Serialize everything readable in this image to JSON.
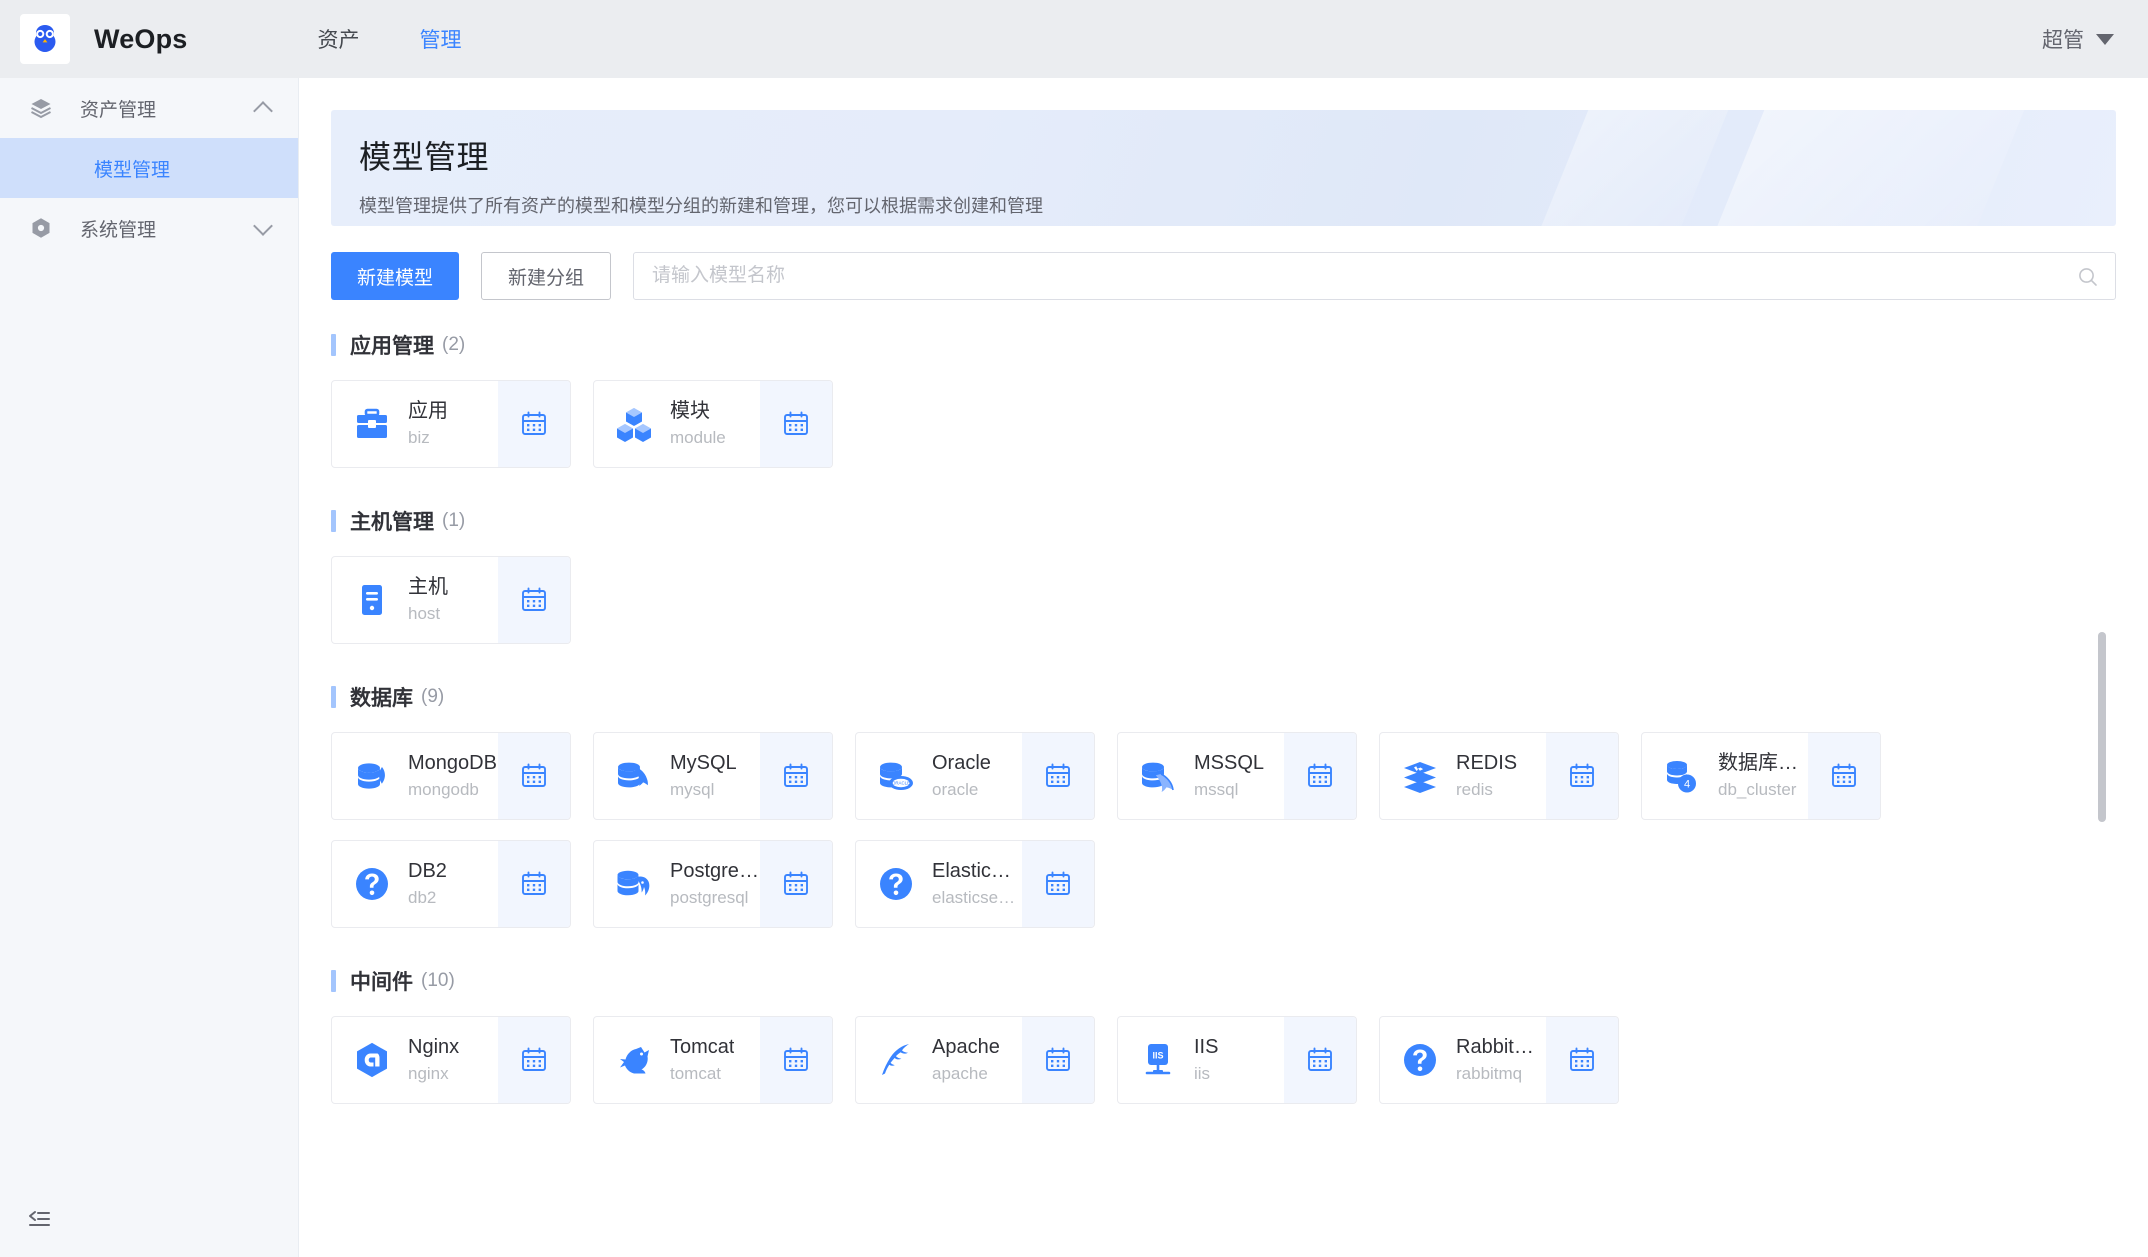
{
  "header": {
    "brand": "WeOps",
    "logo_icon": "owl-logo-icon",
    "nav": [
      {
        "label": "资产",
        "active": false
      },
      {
        "label": "管理",
        "active": true
      }
    ],
    "user": {
      "label": "超管",
      "caret_icon": "caret-down-icon"
    }
  },
  "sidebar": {
    "groups": [
      {
        "label": "资产管理",
        "icon": "layers-icon",
        "chevron": "chevron-up-icon",
        "expanded": true
      },
      {
        "label": "系统管理",
        "icon": "gear-hexagon-icon",
        "chevron": "chevron-down-icon",
        "expanded": false
      }
    ],
    "sub_items": [
      {
        "label": "模型管理",
        "active": true
      }
    ],
    "collapse_icon": "collapse-sidebar-icon"
  },
  "banner": {
    "title": "模型管理",
    "subtitle": "模型管理提供了所有资产的模型和模型分组的新建和管理，您可以根据需求创建和管理"
  },
  "toolbar": {
    "new_model_label": "新建模型",
    "new_group_label": "新建分组",
    "search_placeholder": "请输入模型名称",
    "search_value": "",
    "search_icon": "search-icon"
  },
  "colors": {
    "accent": "#3a84ff",
    "active_nav_bg": "#cfdffb",
    "card_action_bg": "#f2f6fe",
    "icon_blue": "#3a84ff"
  },
  "groups": [
    {
      "name": "应用管理",
      "count": "(2)",
      "models": [
        {
          "title": "应用",
          "code": "biz",
          "icon": "toolbox-icon",
          "action_icon": "calendar-icon"
        },
        {
          "title": "模块",
          "code": "module",
          "icon": "cubes-icon",
          "action_icon": "calendar-icon"
        }
      ]
    },
    {
      "name": "主机管理",
      "count": "(1)",
      "models": [
        {
          "title": "主机",
          "code": "host",
          "icon": "server-icon",
          "action_icon": "calendar-icon"
        }
      ]
    },
    {
      "name": "数据库",
      "count": "(9)",
      "models": [
        {
          "title": "MongoDB",
          "code": "mongodb",
          "icon": "mongodb-icon",
          "action_icon": "calendar-icon"
        },
        {
          "title": "MySQL",
          "code": "mysql",
          "icon": "mysql-icon",
          "action_icon": "calendar-icon"
        },
        {
          "title": "Oracle",
          "code": "oracle",
          "icon": "oracle-icon",
          "action_icon": "calendar-icon"
        },
        {
          "title": "MSSQL",
          "code": "mssql",
          "icon": "mssql-icon",
          "action_icon": "calendar-icon"
        },
        {
          "title": "REDIS",
          "code": "redis",
          "icon": "redis-icon",
          "action_icon": "calendar-icon"
        },
        {
          "title": "数据库集群",
          "code": "db_cluster",
          "icon": "db-cluster-icon",
          "action_icon": "calendar-icon"
        },
        {
          "title": "DB2",
          "code": "db2",
          "icon": "question-circle-icon",
          "action_icon": "calendar-icon"
        },
        {
          "title": "PostgreSQL",
          "code": "postgresql",
          "icon": "postgresql-icon",
          "action_icon": "calendar-icon"
        },
        {
          "title": "ElasticSea...",
          "code": "elasticsearch",
          "icon": "question-circle-icon",
          "action_icon": "calendar-icon"
        }
      ]
    },
    {
      "name": "中间件",
      "count": "(10)",
      "models": [
        {
          "title": "Nginx",
          "code": "nginx",
          "icon": "nginx-icon",
          "action_icon": "calendar-icon"
        },
        {
          "title": "Tomcat",
          "code": "tomcat",
          "icon": "tomcat-icon",
          "action_icon": "calendar-icon"
        },
        {
          "title": "Apache",
          "code": "apache",
          "icon": "apache-feather-icon",
          "action_icon": "calendar-icon"
        },
        {
          "title": "IIS",
          "code": "iis",
          "icon": "iis-icon",
          "action_icon": "calendar-icon"
        },
        {
          "title": "RabbitMQ",
          "code": "rabbitmq",
          "icon": "question-circle-icon",
          "action_icon": "calendar-icon"
        }
      ]
    }
  ]
}
